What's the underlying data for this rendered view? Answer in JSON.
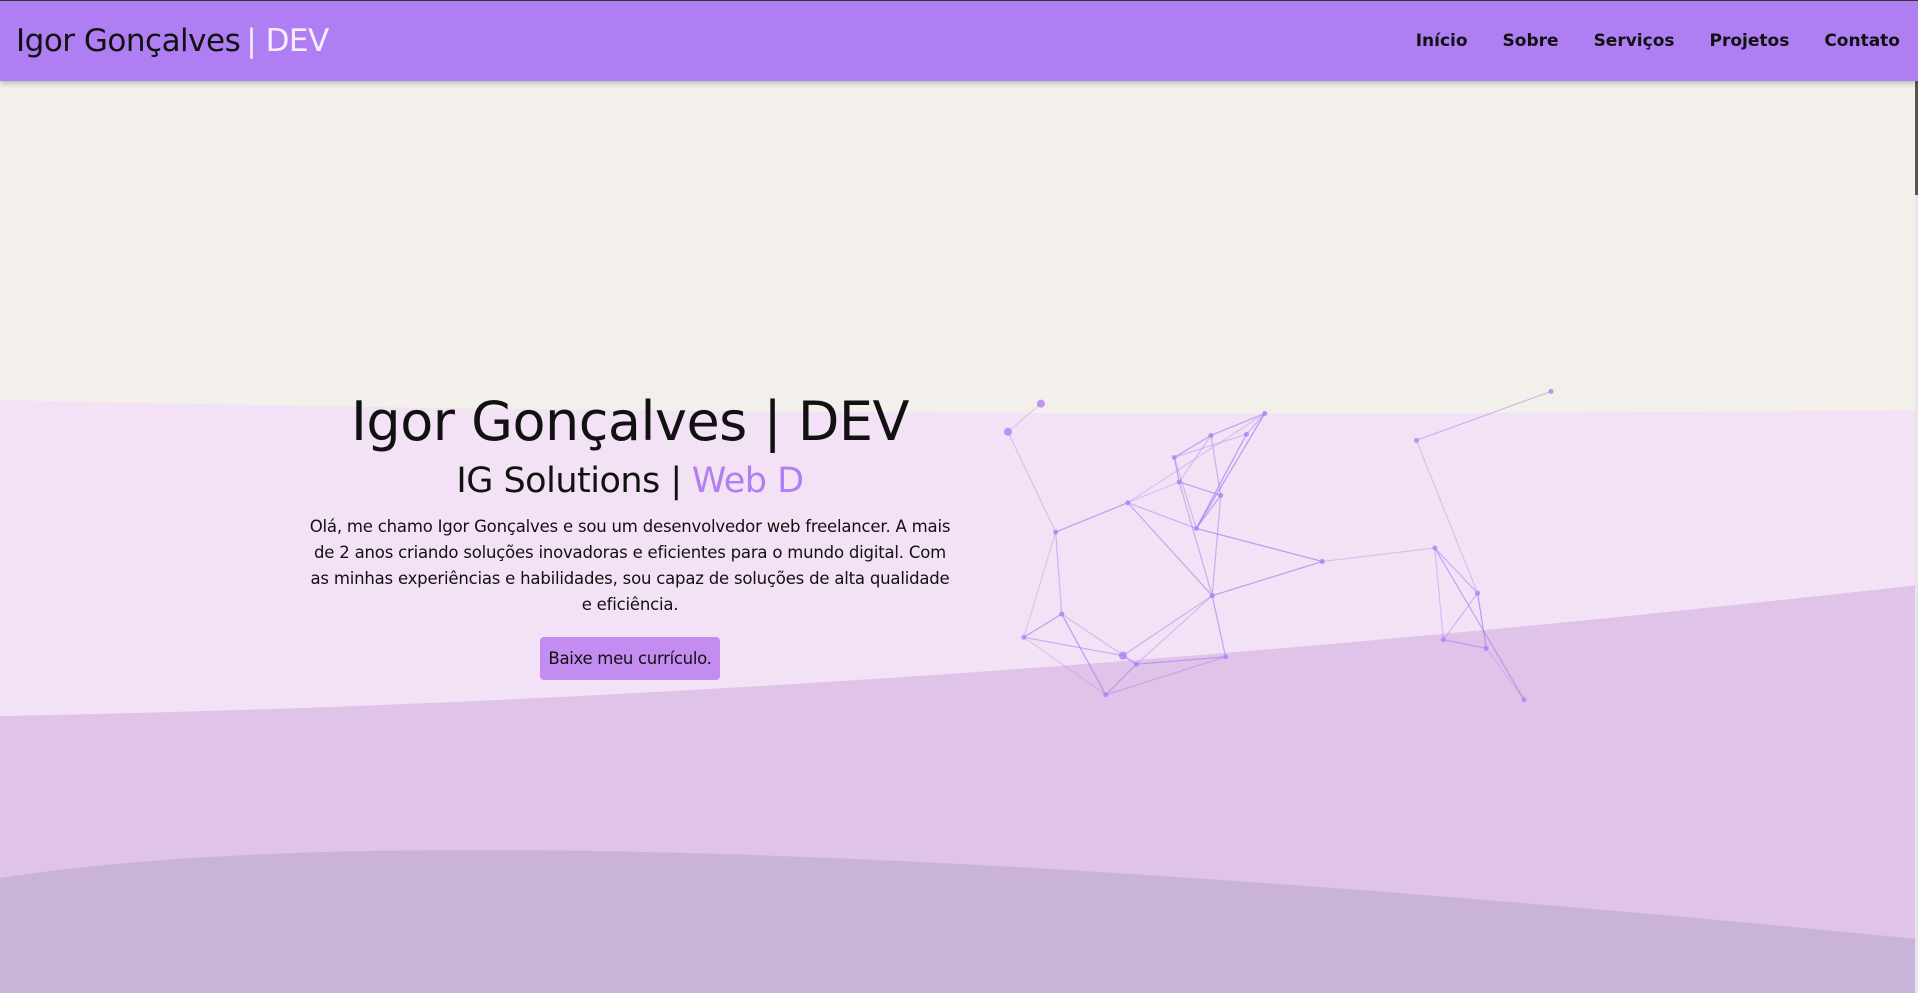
{
  "nav": {
    "logo_name": "Igor Gonçalves",
    "logo_sep": "|",
    "logo_suffix": "DEV",
    "links": [
      "Início",
      "Sobre",
      "Serviços",
      "Projetos",
      "Contato"
    ]
  },
  "hero": {
    "title": "Igor Gonçalves | DEV",
    "subtitle_prefix": "IG Solutions |",
    "subtitle_typed": "Web D",
    "description": "Olá, me chamo Igor Gonçalves e sou um desenvolvedor web freelancer. A mais de 2 anos criando soluções inovadoras e eficientes para o mundo digital. Com as minhas experiências e habilidades, sou capaz de soluções de alta qualidade e eficiência.",
    "cv_button": "Baixe meu currículo."
  },
  "colors": {
    "accent": "#af7ef2",
    "background": "#f3f0eb",
    "wave1": "#f3e1f5",
    "wave2": "#dfc3e8",
    "wave3": "#cab3d8",
    "button": "#c28cf0"
  }
}
